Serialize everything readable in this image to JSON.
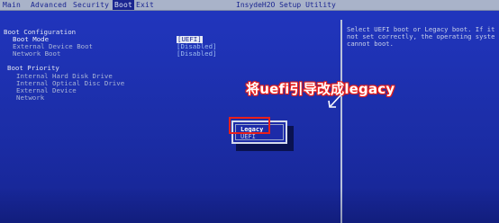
{
  "menubar": {
    "tabs": [
      "Main",
      "Advanced",
      "Security",
      "Boot",
      "Exit"
    ],
    "active_tab": "Boot",
    "utility_title": "InsydeH2O Setup Utility"
  },
  "boot_configuration": {
    "section_title": "Boot Configuration",
    "items": [
      {
        "label": "Boot Mode",
        "value": "[UEFI]"
      },
      {
        "label": "External Device Boot",
        "value": "[Disabled]"
      },
      {
        "label": "Network Boot",
        "value": "[Disabled]"
      }
    ]
  },
  "boot_priority": {
    "section_title": "Boot Priority",
    "items": [
      "Internal Hard Disk Drive",
      "Internal Optical Disc Drive",
      "External Device",
      "Network"
    ]
  },
  "help_panel": {
    "lines": [
      "Select UEFI boot or Legacy boot. If it",
      "not set correctly, the operating syste",
      "cannot boot."
    ]
  },
  "popup": {
    "options": [
      "Legacy",
      "UEFI"
    ],
    "selected": "Legacy"
  },
  "annotation": {
    "text": "将uefi引导改成legacy",
    "color": "#e8201b"
  },
  "colors": {
    "background": "#1d2fb0",
    "menubar": "#a9b3c9",
    "highlight_red": "#e8201b"
  }
}
